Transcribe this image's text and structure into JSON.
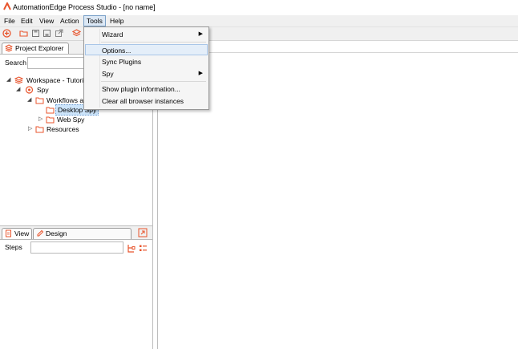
{
  "window": {
    "title": "AutomationEdge Process Studio - [no name]"
  },
  "menubar": {
    "items": [
      {
        "label": "File"
      },
      {
        "label": "Edit"
      },
      {
        "label": "View"
      },
      {
        "label": "Action"
      },
      {
        "label": "Tools"
      },
      {
        "label": "Help"
      }
    ],
    "active": "Tools"
  },
  "tools_menu": {
    "items": [
      {
        "label": "Wizard",
        "submenu": true
      },
      {
        "label": "Options...",
        "submenu": false
      },
      {
        "label": "Sync Plugins",
        "submenu": false
      },
      {
        "label": "Spy",
        "submenu": true
      },
      {
        "label": "Show plugin information...",
        "submenu": false
      },
      {
        "label": "Clear all browser instances",
        "submenu": false
      }
    ],
    "submenu_arrow": "▶",
    "hovered": "Options..."
  },
  "explorer": {
    "tab_label": "Project Explorer",
    "search_label": "Search",
    "search_value": "",
    "tree": [
      {
        "label": "Workspace - Tutoria",
        "level": 0,
        "expander": "◢",
        "icon": "workspace-icon"
      },
      {
        "label": "Spy",
        "level": 1,
        "expander": "◢",
        "icon": "project-icon"
      },
      {
        "label": "Workflows a",
        "level": 2,
        "expander": "◢",
        "icon": "folder-icon"
      },
      {
        "label": "Desktop Spy",
        "level": 3,
        "expander": "",
        "icon": "folder-icon",
        "selected": true
      },
      {
        "label": "Web Spy",
        "level": 3,
        "expander": "▷",
        "icon": "folder-icon"
      },
      {
        "label": "Resources",
        "level": 2,
        "expander": "▷",
        "icon": "folder-icon"
      }
    ]
  },
  "design_panel": {
    "tabs": [
      {
        "label": "View"
      },
      {
        "label": "Design"
      }
    ],
    "steps_label": "Steps",
    "steps_value": ""
  },
  "colors": {
    "accent": "#e8542c",
    "selection": "#cde5fb",
    "menu_hover": "#e4eef9"
  }
}
